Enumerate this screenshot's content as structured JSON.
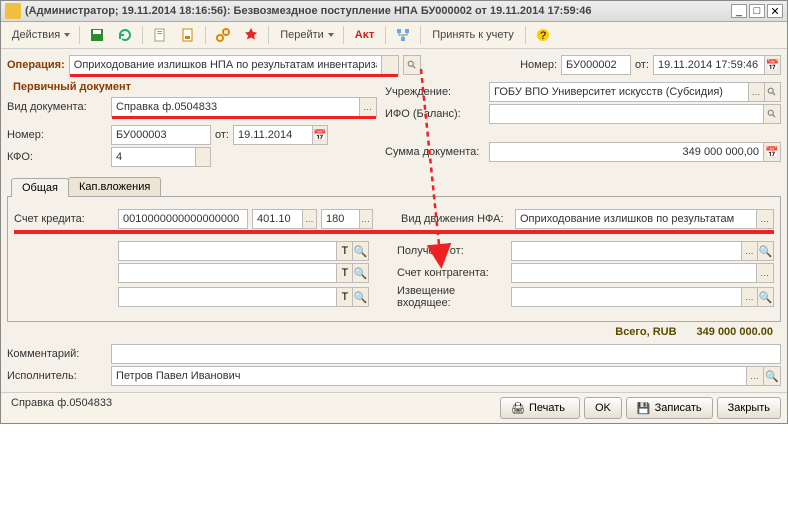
{
  "titlebar": {
    "text": "(Администратор; 19.11.2014 18:16:56): Безвозмездное поступление НПА БУ000002 от 19.11.2014 17:59:46"
  },
  "toolbar": {
    "actions": "Действия",
    "goto": "Перейти",
    "akt": "Аᴋᴛ",
    "accept": "Принять к учету"
  },
  "operation": {
    "label": "Операция:",
    "value": "Оприходование излишков НПА по результатам инвентаризации",
    "number_label": "Номер:",
    "number": "БУ000002",
    "from_label": "от:",
    "date": "19.11.2014 17:59:46"
  },
  "primary_doc_title": "Первичный документ",
  "doc": {
    "type_label": "Вид документа:",
    "type_value": "Справка ф.0504833",
    "number_label": "Номер:",
    "number_value": "БУ000003",
    "from_label": "от:",
    "date_value": "19.11.2014",
    "kfo_label": "КФО:",
    "kfo_value": "4"
  },
  "right": {
    "org_label": "Учреждение:",
    "org_value": "ГОБУ ВПО Университет искусств (Субсидия)",
    "ifo_label": "ИФО (Баланс):",
    "ifo_value": "",
    "sum_label": "Сумма документа:",
    "sum_value": "349 000 000,00"
  },
  "tabs": {
    "t1": "Общая",
    "t2": "Кап.вложения"
  },
  "panel": {
    "credit_label": "Счет кредита:",
    "credit_code": "0010000000000000000",
    "credit_acc": "401.10",
    "credit_sub": "180",
    "nfa_label": "Вид движения НФА:",
    "nfa_value": "Оприходование излишков по результатам",
    "received_label": "Получено от:",
    "received_value": "",
    "counter_label": "Счет контрагента:",
    "counter_value": "",
    "notice_label": "Извещение входящее:",
    "notice_value": ""
  },
  "totals": {
    "label": "Всего, RUB",
    "value": "349 000 000.00"
  },
  "footer": {
    "comment_label": "Комментарий:",
    "comment_value": "",
    "executor_label": "Исполнитель:",
    "executor_value": "Петров Павел Иванович"
  },
  "status": "Справка ф.0504833",
  "buttons": {
    "print": "Печать",
    "ok": "OK",
    "save": "Записать",
    "close": "Закрыть"
  }
}
